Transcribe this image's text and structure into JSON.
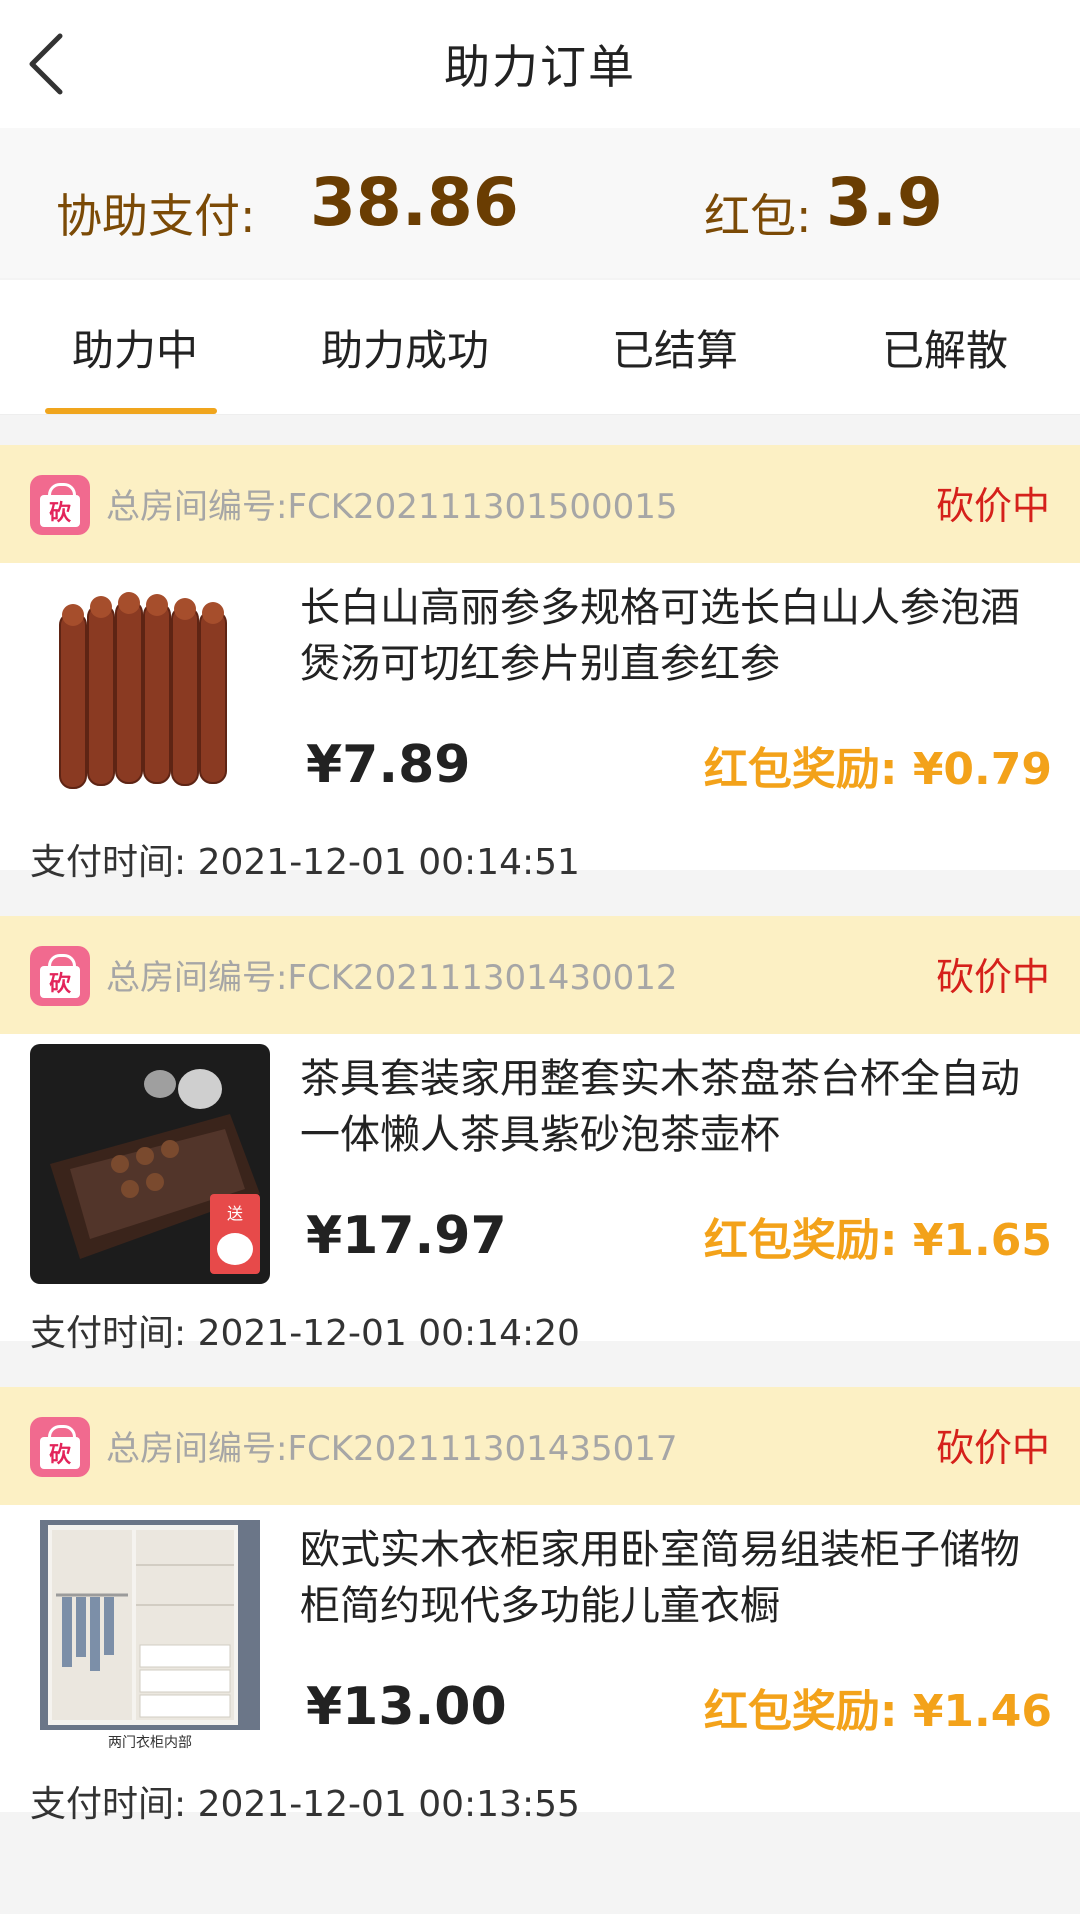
{
  "header": {
    "title": "助力订单"
  },
  "summary": {
    "pay_label": "协助支付:",
    "pay_value": "38.86",
    "redpacket_label": "红包:",
    "redpacket_value": "3.9"
  },
  "tabs": [
    {
      "label": "助力中",
      "active": true
    },
    {
      "label": "助力成功"
    },
    {
      "label": "已结算"
    },
    {
      "label": "已解散"
    }
  ],
  "colors": {
    "accent": "#f0a51d",
    "status_red": "#d5211b",
    "reward_orange": "#f3a21a",
    "summary_brown": "#6a3d02",
    "header_band": "#fcf0c4"
  },
  "orders": [
    {
      "room": "总房间编号:FCK202111301500015",
      "status": "砍价中",
      "title": "长白山高丽参多规格可选长白山人参泡酒煲汤可切红参片别直参红参",
      "price": "¥7.89",
      "reward": "红包奖励: ¥0.79",
      "paytime": "支付时间:  2021-12-01 00:14:51",
      "image": "red-ginseng-image"
    },
    {
      "room": "总房间编号:FCK202111301430012",
      "status": "砍价中",
      "title": "茶具套装家用整套实木茶盘茶台杯全自动一体懒人茶具紫砂泡茶壶杯",
      "price": "¥17.97",
      "reward": "红包奖励: ¥1.65",
      "paytime": "支付时间:  2021-12-01 00:14:20",
      "image": "tea-set-image",
      "image_badge": "送"
    },
    {
      "room": "总房间编号:FCK202111301435017",
      "status": "砍价中",
      "title": "欧式实木衣柜家用卧室简易组装柜子储物柜简约现代多功能儿童衣橱",
      "price": "¥13.00",
      "reward": "红包奖励: ¥1.46",
      "paytime": "支付时间:  2021-12-01 00:13:55",
      "image": "wardrobe-image",
      "image_caption": "两门衣柜内部"
    }
  ],
  "icons": {
    "back": "chevron-left-icon",
    "bag": "bargain-bag-icon",
    "bag_char": "砍"
  }
}
